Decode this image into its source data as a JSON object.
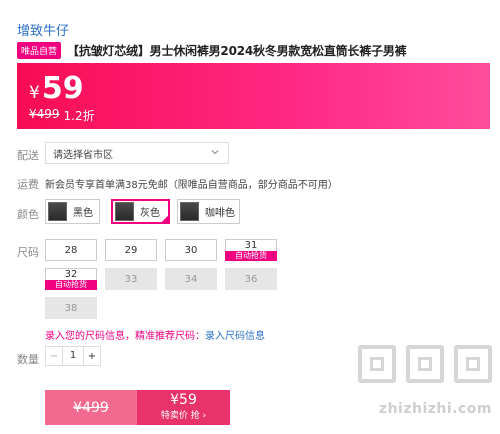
{
  "brand": "增致牛仔",
  "product": {
    "tag": "唯品自营",
    "title": "【抗皱灯芯绒】男士休闲裤男2024秋冬男款宽松直筒长裤子男裤"
  },
  "price": {
    "currency": "¥",
    "current": "59",
    "original": "¥499",
    "discount": "1.2折"
  },
  "shipping": {
    "label": "配送",
    "select_value": "请选择省市区"
  },
  "freight": {
    "label": "运费",
    "text": "新会员专享首单满38元免邮（限唯品自营商品，部分商品不可用）"
  },
  "color": {
    "label": "颜色",
    "options": [
      "黑色",
      "灰色",
      "咖啡色"
    ],
    "selected": "灰色"
  },
  "size": {
    "label": "尺码",
    "options": [
      "28",
      "29",
      "30",
      "31",
      "32",
      "33",
      "34",
      "36",
      "38"
    ],
    "hot_tag": "自动抢货",
    "tip_red": "录入您的尺码信息，精准推荐尺码：",
    "tip_link": "录入尺码信息"
  },
  "quantity": {
    "label": "数量",
    "minus": "−",
    "value": "1",
    "plus": "+"
  },
  "buy": {
    "original_price": "¥499",
    "sale_price": "¥59",
    "sale_label": "特卖价 抢 ›"
  },
  "watermark": {
    "text": "zhizhizhi.com"
  },
  "colors": {
    "accent": "#f10180",
    "link": "#2a6fc7",
    "price_gradient_start": "#f80c53",
    "price_gradient_end": "#ff4d9c"
  }
}
